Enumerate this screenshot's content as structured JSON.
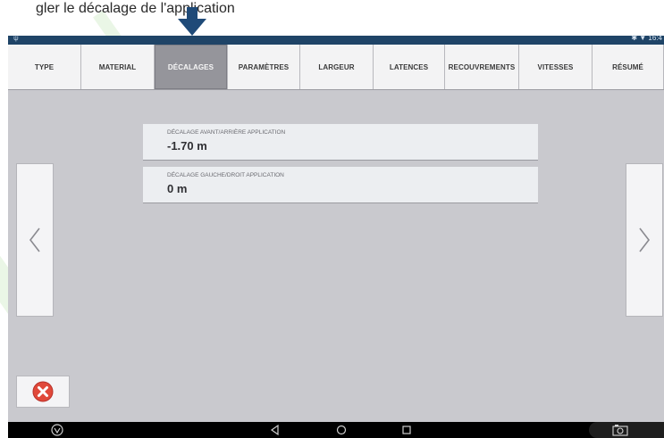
{
  "caption": "gler le décalage de l'application",
  "status": {
    "left": "ψ",
    "right": "✱ ▼ 16:4"
  },
  "tabs": [
    {
      "label": "TYPE",
      "active": false
    },
    {
      "label": "MATERIAL",
      "active": false
    },
    {
      "label": "DÉCALAGES",
      "active": true
    },
    {
      "label": "PARAMÈTRES",
      "active": false
    },
    {
      "label": "LARGEUR",
      "active": false
    },
    {
      "label": "LATENCES",
      "active": false
    },
    {
      "label": "RECOUVREMENTS",
      "active": false
    },
    {
      "label": "VITESSES",
      "active": false
    },
    {
      "label": "RÉSUMÉ",
      "active": false
    }
  ],
  "fields": [
    {
      "label": "DÉCALAGE AVANT/ARRIÈRE APPLICATION",
      "value": "-1.70 m"
    },
    {
      "label": "DÉCALAGE GAUCHE/DROIT APPLICATION",
      "value": "0 m"
    }
  ],
  "icons": {
    "prev": "chevron-left-icon",
    "next": "chevron-right-icon",
    "cancel": "red-x-icon",
    "pointer": "down-arrow-icon"
  },
  "colors": {
    "status_bar": "#1f4467",
    "active_tab": "#95959b",
    "cancel_red": "#e0493a",
    "pointer_blue": "#1f4a78"
  }
}
